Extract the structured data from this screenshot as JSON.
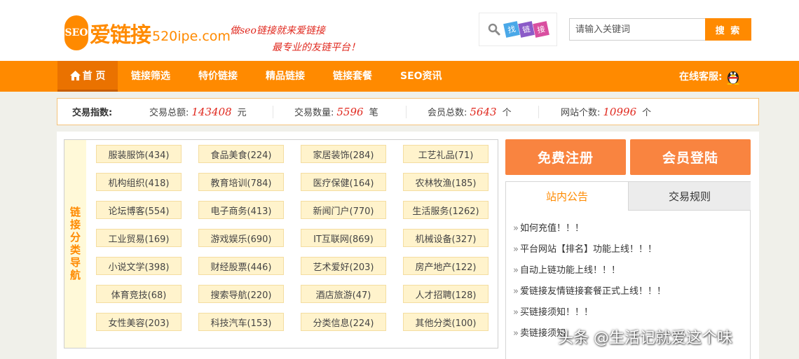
{
  "header": {
    "logo_mark": "SEO",
    "logo_name": "爱链接",
    "logo_domain": "520ipe.com",
    "slogan_line1": "做seo链接就来爱链接",
    "slogan_line2": "最专业的友链平台！",
    "finder_tags": [
      "找",
      "链",
      "接"
    ]
  },
  "search": {
    "placeholder": "请输入关键词",
    "button_label": "搜 索"
  },
  "nav": {
    "home": "首 页",
    "items": [
      "链接筛选",
      "特价链接",
      "精品链接",
      "链接套餐",
      "SEO资讯"
    ],
    "service_label": "在线客服:"
  },
  "stats": {
    "title": "交易指数:",
    "items": [
      {
        "label": "交易总额:",
        "value": "143408",
        "unit": "元"
      },
      {
        "label": "交易数量:",
        "value": "5596",
        "unit": "笔"
      },
      {
        "label": "会员总数:",
        "value": "5643",
        "unit": "个"
      },
      {
        "label": "网站个数:",
        "value": "10996",
        "unit": "个"
      }
    ]
  },
  "categories": {
    "side_title": "链接分类导航",
    "items": [
      "服装服饰(434)",
      "食品美食(224)",
      "家居装饰(284)",
      "工艺礼品(71)",
      "机构组织(418)",
      "教育培训(784)",
      "医疗保健(164)",
      "农林牧渔(185)",
      "论坛博客(554)",
      "电子商务(413)",
      "新闻门户(770)",
      "生活服务(1262)",
      "工业贸易(169)",
      "游戏娱乐(690)",
      "IT互联网(869)",
      "机械设备(327)",
      "小说文学(398)",
      "财经股票(446)",
      "艺术爱好(203)",
      "房产地产(122)",
      "体育竞技(68)",
      "搜索导航(220)",
      "酒店旅游(47)",
      "人才招聘(128)",
      "女性美容(203)",
      "科技汽车(153)",
      "分类信息(224)",
      "其他分类(100)"
    ]
  },
  "actions": {
    "register": "免费注册",
    "login": "会员登陆"
  },
  "notice": {
    "tab_active": "站内公告",
    "tab_inactive": "交易规则",
    "items": [
      "如何充值！！！",
      "平台网站【排名】功能上线！！！",
      "自动上链功能上线！！！",
      "爱链接友情链接套餐正式上线！！！",
      "买链接须知！！！",
      "卖链接须知"
    ]
  },
  "watermark": "头条 @生活记就爱这个味",
  "colors": {
    "brand_orange": "#ff8a00",
    "value_red": "#e0281e",
    "action_orange": "#f98440"
  }
}
